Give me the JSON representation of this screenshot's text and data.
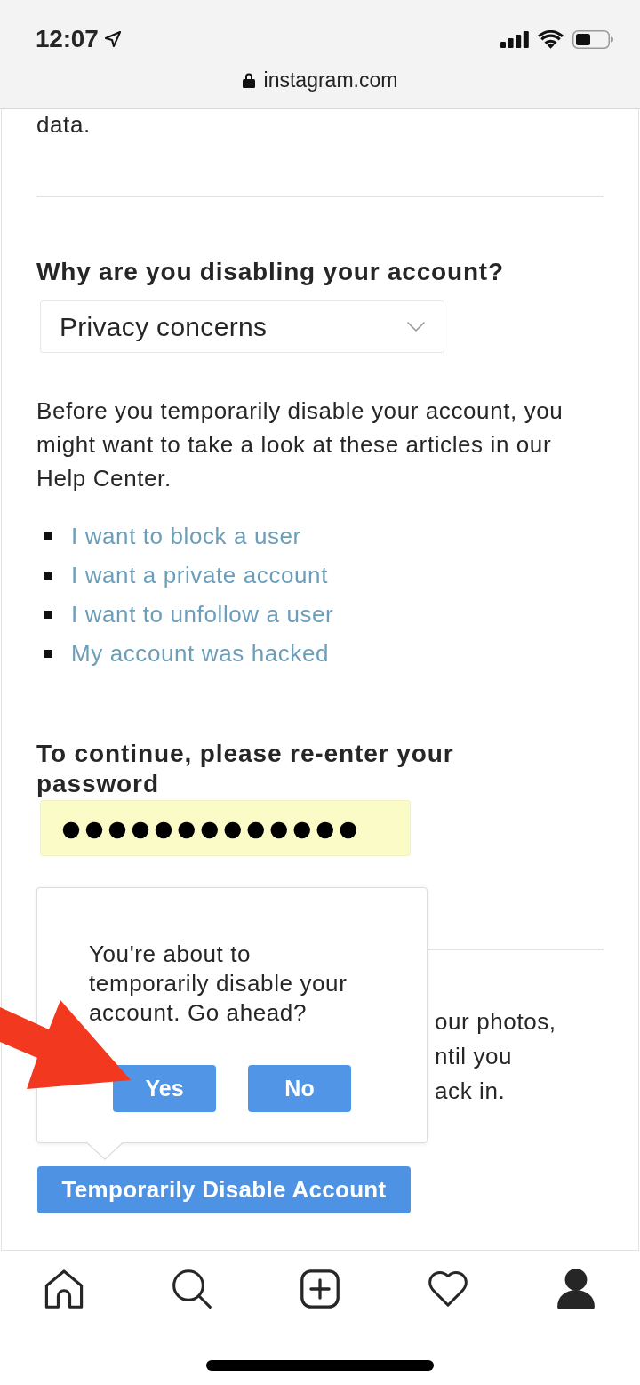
{
  "status_bar": {
    "time": "12:07"
  },
  "address_bar": {
    "url": "instagram.com"
  },
  "content": {
    "text_fragment": "data.",
    "reason": {
      "heading": "Why are you disabling your account?",
      "select": {
        "value": "Privacy concerns"
      }
    },
    "help_intro": "Before you temporarily disable your account, you might want to take a look at these articles in our Help Center.",
    "help_links": [
      "I want to block a user",
      "I want a private account",
      "I want to unfollow a user",
      "My account was hacked"
    ],
    "password": {
      "heading": "To continue, please re-enter your password",
      "value": "●●●●●●●●●●●●●"
    },
    "text_behind_popover": [
      "our photos,",
      "ntil you",
      "ack in."
    ],
    "disable_button": {
      "label": "Temporarily Disable Account"
    }
  },
  "confirm_popover": {
    "message": "You're about to temporarily disable your account. Go ahead?",
    "buttons": [
      {
        "label": "Yes"
      },
      {
        "label": "No"
      }
    ]
  },
  "tab_bar": {
    "items": [
      {
        "kind": "home",
        "selected": false
      },
      {
        "kind": "search",
        "selected": false
      },
      {
        "kind": "new_post",
        "selected": false
      },
      {
        "kind": "activity",
        "selected": false
      },
      {
        "kind": "profile",
        "selected": true
      }
    ]
  }
}
